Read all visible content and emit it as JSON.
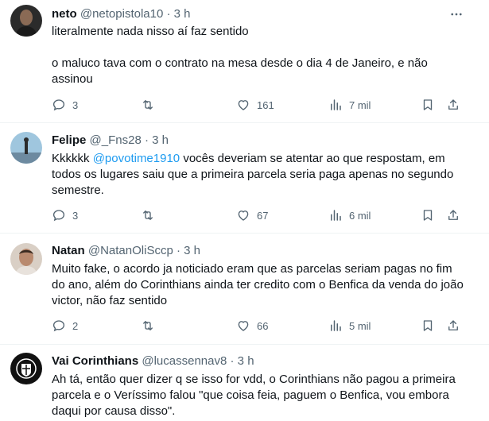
{
  "tweets": [
    {
      "name": "neto",
      "handle": "@netopistola10",
      "time": "· 3 h",
      "text_lines": [
        "literalmente nada nisso aí faz sentido",
        "",
        "o maluco tava com o contrato na mesa desde o dia 4 de Janeiro, e não assinou"
      ],
      "replies": "3",
      "retweets": "",
      "likes": "161",
      "views": "7 mil"
    },
    {
      "name": "Felipe",
      "handle": "@_Fns28",
      "time": "· 3 h",
      "text_prefix": "Kkkkkk ",
      "mention": "@povotime1910",
      "text_suffix": " vocês deveriam se atentar ao que respostam, em todos os lugares saiu que a primeira parcela seria paga apenas no segundo semestre.",
      "replies": "3",
      "retweets": "",
      "likes": "67",
      "views": "6 mil"
    },
    {
      "name": "Natan",
      "handle": "@NatanOliSccp",
      "time": "· 3 h",
      "text": "Muito fake, o acordo ja noticiado eram que as parcelas seriam pagas no fim do ano, além do Corinthians ainda ter credito com o Benfica da venda do joão victor, não faz sentido",
      "replies": "2",
      "retweets": "",
      "likes": "66",
      "views": "5 mil"
    },
    {
      "name": "Vai Corinthians",
      "handle": "@lucassennav8",
      "time": "· 3 h",
      "text": "Ah tá, então quer dizer q se isso for vdd, o Corinthians não pagou a primeira parcela e o Veríssimo falou \"que coisa feia, paguem o Benfica, vou embora daqui por causa disso\"."
    }
  ],
  "icons": [
    "more-icon",
    "reply-icon",
    "retweet-icon",
    "like-icon",
    "views-icon",
    "bookmark-icon",
    "share-icon"
  ],
  "colors": {
    "text": "#0f1419",
    "secondary": "#536471",
    "link": "#1d9bf0",
    "divider": "#eff3f4"
  }
}
